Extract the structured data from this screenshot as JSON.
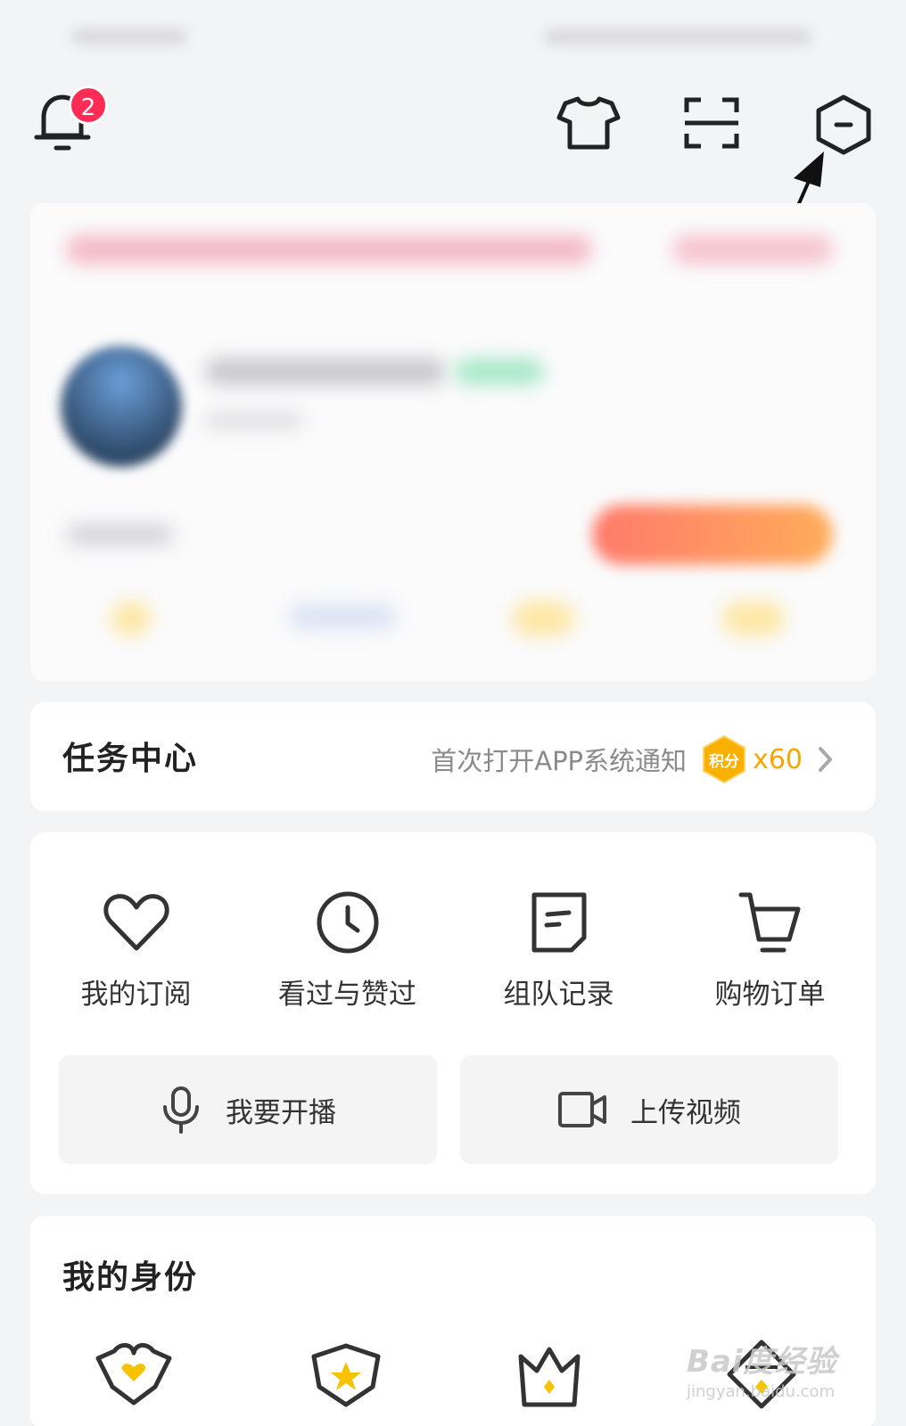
{
  "notifications": {
    "badge_count": "2"
  },
  "task_center": {
    "title": "任务中心",
    "description": "首次打开APP系统通知",
    "points_label": "积分",
    "points_count": "x60"
  },
  "quick_menu": [
    {
      "label": "我的订阅",
      "icon": "heart-icon"
    },
    {
      "label": "看过与赞过",
      "icon": "clock-icon"
    },
    {
      "label": "组队记录",
      "icon": "note-icon"
    },
    {
      "label": "购物订单",
      "icon": "cart-icon"
    }
  ],
  "actions": {
    "go_live": "我要开播",
    "upload_video": "上传视频"
  },
  "identity": {
    "title": "我的身份"
  },
  "watermark": {
    "main": "Bai度经验",
    "sub": "jingyan.baidu.com"
  },
  "colors": {
    "badge": "#ff2d55",
    "points": "#f7a600",
    "background": "#f3f4f6"
  }
}
